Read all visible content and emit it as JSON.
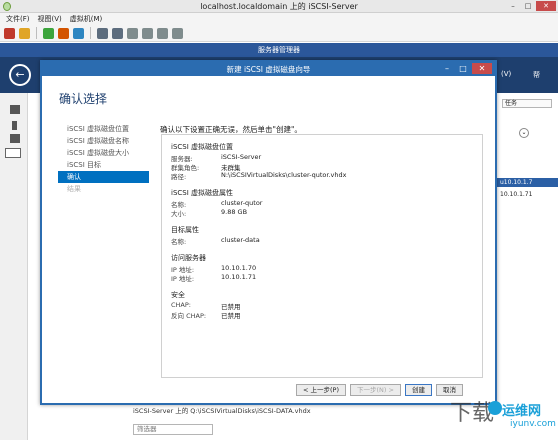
{
  "vm": {
    "title": "localhost.localdomain 上的 iSCSI-Server",
    "menu": [
      "文件(F)",
      "视图(V)",
      "虚拟机(M)"
    ],
    "controls": {
      "minimize": "–",
      "maximize": "□",
      "close": "✕"
    }
  },
  "server_manager": {
    "title": "服务器管理器",
    "back_glyph": "←",
    "header_right": {
      "col1": "(V)",
      "col2": "帮"
    },
    "tasks_label": "任务",
    "right_rows": [
      "u10.10.1.7",
      "10.10.1.71"
    ],
    "bottom_path": "iSCSI-Server 上的 Q:\\iSCSIVirtualDisks\\iSCSI-DATA.vhdx",
    "filter_placeholder": "筛选器"
  },
  "wizard": {
    "title": "新建 iSCSI 虚拟磁盘向导",
    "heading": "确认选择",
    "steps": [
      {
        "label": "iSCSI 虚拟磁盘位置",
        "state": "done"
      },
      {
        "label": "iSCSI 虚拟磁盘名称",
        "state": "done"
      },
      {
        "label": "iSCSI 虚拟磁盘大小",
        "state": "done"
      },
      {
        "label": "iSCSI 目标",
        "state": "done"
      },
      {
        "label": "确认",
        "state": "current"
      },
      {
        "label": "结果",
        "state": "disabled"
      }
    ],
    "lead": "确认以下设置正确无误，然后单击\"创建\"。",
    "sections": {
      "location": {
        "title": "iSCSI 虚拟磁盘位置",
        "server_label": "服务器:",
        "server_value": "iSCSI-Server",
        "cluster_label": "群集角色:",
        "cluster_value": "未群集",
        "path_label": "路径:",
        "path_value": "N:\\iSCSIVirtualDisks\\cluster-qutor.vhdx"
      },
      "properties": {
        "title": "iSCSI 虚拟磁盘属性",
        "name_label": "名称:",
        "name_value": "cluster-qutor",
        "size_label": "大小:",
        "size_value": "9.88 GB"
      },
      "target": {
        "title": "目标属性",
        "name_label": "名称:",
        "name_value": "cluster-data"
      },
      "access": {
        "title": "访问服务器",
        "ip1_label": "IP 地址:",
        "ip1_value": "10.10.1.70",
        "ip2_label": "IP 地址:",
        "ip2_value": "10.10.1.71"
      },
      "security": {
        "title": "安全",
        "chap_label": "CHAP:",
        "chap_value": "已禁用",
        "rchap_label": "反向 CHAP:",
        "rchap_value": "已禁用"
      }
    },
    "buttons": {
      "prev": "< 上一步(P)",
      "next": "下一步(N) >",
      "create": "创建",
      "cancel": "取消"
    }
  },
  "watermark": {
    "brand": "运维网",
    "url": "iyunv.com",
    "script": "下载"
  },
  "colors": {
    "accent": "#2b6cb0",
    "header": "#1e3f6e",
    "step_current": "#0070c0"
  }
}
